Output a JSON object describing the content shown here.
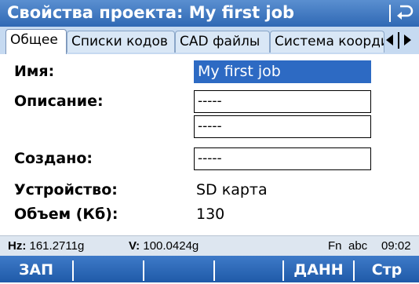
{
  "titlebar": {
    "title": "Свойства проекта: My first job",
    "back_icon": "back-arrow-icon"
  },
  "tabs": [
    {
      "label": "Общее",
      "active": true
    },
    {
      "label": "Списки кодов",
      "active": false
    },
    {
      "label": "CAD файлы",
      "active": false
    },
    {
      "label": "Система коорди",
      "active": false
    }
  ],
  "form": {
    "name_label": "Имя:",
    "name_value": "My first job",
    "description_label": "Описание:",
    "description_line1": "-----",
    "description_line2": "-----",
    "created_label": "Создано:",
    "created_value": "-----",
    "device_label": "Устройство:",
    "device_value": "SD карта",
    "size_label": "Объем (Кб):",
    "size_value": "130"
  },
  "status": {
    "hz_label": "Hz:",
    "hz_value": "161.2711g",
    "v_label": "V:",
    "v_value": "100.0424g",
    "fn": "Fn",
    "input_mode": "abc",
    "time": "09:02"
  },
  "fkeys": {
    "f1": "ЗАП",
    "f2": "",
    "f3": "",
    "f4": "",
    "f5": "ДАНН",
    "f6": "Стр"
  }
}
